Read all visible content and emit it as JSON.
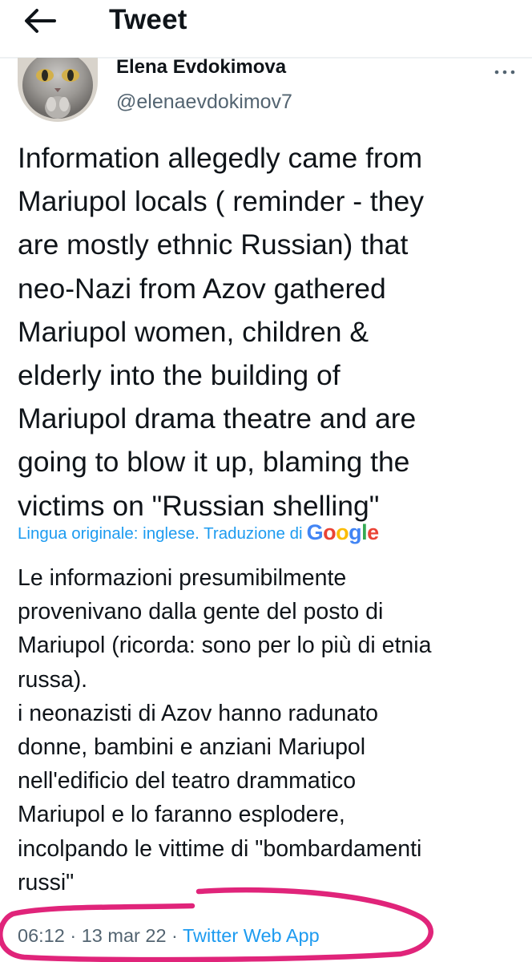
{
  "header": {
    "title": "Tweet",
    "back_icon": "arrow-left-icon"
  },
  "author": {
    "name": "Elena Evdokimova",
    "handle": "@elenaevdokimov7",
    "avatar_icon": "cat-avatar-image"
  },
  "tweet": {
    "text": "Information allegedly came from\nMariupol locals ( reminder - they\nare mostly ethnic Russian) that\nneo-Nazi from Azov gathered\nMariupol women, children &\nelderly into the building of\nMariupol drama theatre and are\ngoing to blow it up, blaming the\nvictims on \"Russian shelling\"",
    "translation_note": "Lingua originale: inglese. Traduzione di",
    "translation_provider": "Google",
    "translated_text": "Le informazioni presumibilmente\nprovenivano dalla gente del posto di\nMariupol (ricorda: sono per lo più di etnia\nrussa).\n i neonazisti di Azov hanno radunato\ndonne, bambini e anziani Mariupol\nnell'edificio del teatro drammatico\nMariupol e lo faranno esplodere,\nincolpando le vittime di \"bombardamenti\nrussi\""
  },
  "meta": {
    "time": "06:12",
    "separator": " · ",
    "date": "13 mar 22",
    "app": "Twitter Web App"
  },
  "colors": {
    "text": "#0f1419",
    "secondary": "#536471",
    "link": "#1d9bf0",
    "annotation": "#e0247a",
    "google_blue": "#4285f4",
    "google_red": "#ea4335",
    "google_yellow": "#fbbc05",
    "google_green": "#34a853"
  }
}
